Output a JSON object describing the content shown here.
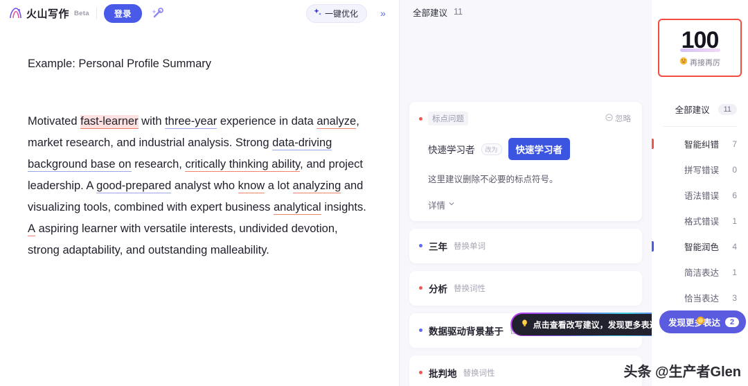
{
  "header": {
    "brand_name": "火山写作",
    "beta": "Beta",
    "login_label": "登录",
    "magic_icon": "magic-wand-icon",
    "optimize_label": "一键优化",
    "optimize_icon": "sparkle-icon",
    "collapse_icon": "double-chevron-right-icon"
  },
  "document": {
    "title": "Example: Personal Profile Summary",
    "paragraph_parts": [
      {
        "text": "Motivated ",
        "mark": "none"
      },
      {
        "text": "fast-learner",
        "mark": "red-highlight"
      },
      {
        "text": " with ",
        "mark": "none"
      },
      {
        "text": "three-year",
        "mark": "blue"
      },
      {
        "text": " experience in data ",
        "mark": "none"
      },
      {
        "text": "analyze",
        "mark": "red"
      },
      {
        "text": ", market research, and industrial analysis. Strong ",
        "mark": "none"
      },
      {
        "text": "data-driving background base on",
        "mark": "blue"
      },
      {
        "text": " research, ",
        "mark": "none"
      },
      {
        "text": "critically thinking ability",
        "mark": "red"
      },
      {
        "text": ", and project leadership. A ",
        "mark": "none"
      },
      {
        "text": "good-prepared",
        "mark": "blue"
      },
      {
        "text": " analyst who ",
        "mark": "none"
      },
      {
        "text": "know",
        "mark": "red"
      },
      {
        "text": " a lot ",
        "mark": "none"
      },
      {
        "text": "analyzing",
        "mark": "red"
      },
      {
        "text": " and visualizing tools, combined with expert business ",
        "mark": "none"
      },
      {
        "text": "analytical",
        "mark": "red"
      },
      {
        "text": " insights. ",
        "mark": "none"
      },
      {
        "text": "A",
        "mark": "red"
      },
      {
        "text": " aspiring learner with versatile interests, undivided devotion, strong adaptability, and outstanding malleability.",
        "mark": "none"
      }
    ]
  },
  "suggestions": {
    "header_label": "全部建议",
    "header_count": "11",
    "card": {
      "dot_color": "#f3564e",
      "tag": "标点问题",
      "ignore_label": "忽略",
      "ignore_icon": "minus-circle-icon",
      "original": "快速学习者",
      "arrow": "改为",
      "replacement": "快速学习者",
      "explanation": "这里建议删除不必要的标点符号。",
      "detail_label": "详情",
      "detail_icon": "chevron-down-icon"
    },
    "rows": [
      {
        "dot": "blue",
        "word": "三年",
        "kind": "替换单词"
      },
      {
        "dot": "red",
        "word": "分析",
        "kind": "替换词性"
      },
      {
        "dot": "blue",
        "word": "数据驱动背景基于",
        "kind": "替换单词"
      },
      {
        "dot": "red",
        "word": "批判地",
        "kind": "替换词性"
      }
    ],
    "tooltip": {
      "icon": "lightbulb-icon",
      "text": "点击查看改写建议，发现更多表达"
    }
  },
  "score_panel": {
    "score": "100",
    "score_label": "再接再厉",
    "score_emoji": "emoji-grinning",
    "categories": [
      {
        "name": "全部建议",
        "count": "11",
        "bar": "none",
        "style": "pill",
        "sub": false
      },
      {
        "name": "智能纠错",
        "count": "7",
        "bar": "red",
        "style": "plain",
        "sub": false
      },
      {
        "name": "拼写错误",
        "count": "0",
        "bar": "none",
        "style": "plain",
        "sub": true
      },
      {
        "name": "语法错误",
        "count": "6",
        "bar": "none",
        "style": "plain",
        "sub": true
      },
      {
        "name": "格式错误",
        "count": "1",
        "bar": "none",
        "style": "plain",
        "sub": true
      },
      {
        "name": "智能润色",
        "count": "4",
        "bar": "blue",
        "style": "plain",
        "sub": false
      },
      {
        "name": "简洁表达",
        "count": "1",
        "bar": "none",
        "style": "plain",
        "sub": true
      },
      {
        "name": "恰当表达",
        "count": "3",
        "bar": "none",
        "style": "plain",
        "sub": true
      }
    ],
    "discover": {
      "label": "发现更多表达",
      "count": "2",
      "emoji": "emoji-sun"
    }
  },
  "watermark": "头条 @生产者Glen",
  "colors": {
    "accent_blue": "#4a5ae8",
    "error_red": "#f3564e",
    "score_border": "#f24b3f",
    "panel_bg": "#f7f7fc"
  }
}
